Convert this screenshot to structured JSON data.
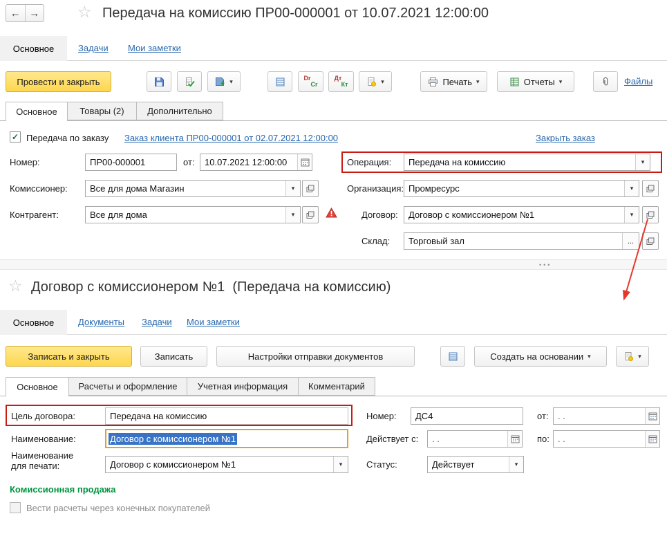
{
  "icons": {
    "back": "←",
    "forward": "→",
    "star": "☆",
    "caret": "▾",
    "check": "✓",
    "more": "...",
    "splitter_dots": "•••"
  },
  "doc1": {
    "title": "Передача на комиссию ПР00-000001 от 10.07.2021 12:00:00",
    "nav": {
      "main": "Основное",
      "tasks": "Задачи",
      "notes": "Мои заметки"
    },
    "toolbar": {
      "post_and_close": "Провести и закрыть",
      "print": "Печать",
      "reports": "Отчеты",
      "files": "Файлы",
      "dr": "Dr",
      "cr": "Cr",
      "dt": "Дт",
      "kt": "Кт"
    },
    "tabs": {
      "main": "Основное",
      "goods": "Товары (2)",
      "additional": "Дополнительно"
    },
    "order": {
      "by_order_label": "Передача по заказу",
      "order_link": "Заказ клиента ПР00-000001 от 02.07.2021 12:00:00",
      "close_order_link": "Закрыть заказ"
    },
    "fields": {
      "number_label": "Номер:",
      "number_value": "ПР00-000001",
      "date_label": "от:",
      "date_value": "10.07.2021 12:00:00",
      "operation_label": "Операция:",
      "operation_value": "Передача на комиссию",
      "commissioner_label": "Комиссионер:",
      "commissioner_value": "Все для дома Магазин",
      "organization_label": "Организация:",
      "organization_value": "Промресурс",
      "counterparty_label": "Контрагент:",
      "counterparty_value": "Все для дома",
      "contract_label": "Договор:",
      "contract_value": "Договор с комиссионером №1",
      "warehouse_label": "Склад:",
      "warehouse_value": "Торговый зал"
    }
  },
  "doc2": {
    "title": "Договор с комиссионером №1  (Передача на комиссию)",
    "nav": {
      "main": "Основное",
      "documents": "Документы",
      "tasks": "Задачи",
      "notes": "Мои заметки"
    },
    "toolbar": {
      "save_and_close": "Записать и закрыть",
      "save": "Записать",
      "send_settings": "Настройки отправки документов",
      "create_based_on": "Создать на основании"
    },
    "tabs": {
      "main": "Основное",
      "calculations": "Расчеты и оформление",
      "accounting": "Учетная информация",
      "comment": "Комментарий"
    },
    "fields": {
      "purpose_label": "Цель договора:",
      "purpose_value": "Передача на комиссию",
      "number_label": "Номер:",
      "number_value": "ДС4",
      "from_label": "от:",
      "from_value": ". .",
      "name_label": "Наименование:",
      "name_value": "Договор с комиссионером №1",
      "valid_from_label": "Действует с:",
      "valid_from_value": ". .",
      "to_label": "по:",
      "to_value": ". .",
      "print_name_label_1": "Наименование",
      "print_name_label_2": "для печати:",
      "print_name_value": "Договор с комиссионером №1",
      "status_label": "Статус:",
      "status_value": "Действует"
    },
    "section": {
      "commission_sale": "Комиссионная продажа",
      "settlements_checkbox": "Вести расчеты через конечных покупателей"
    }
  }
}
